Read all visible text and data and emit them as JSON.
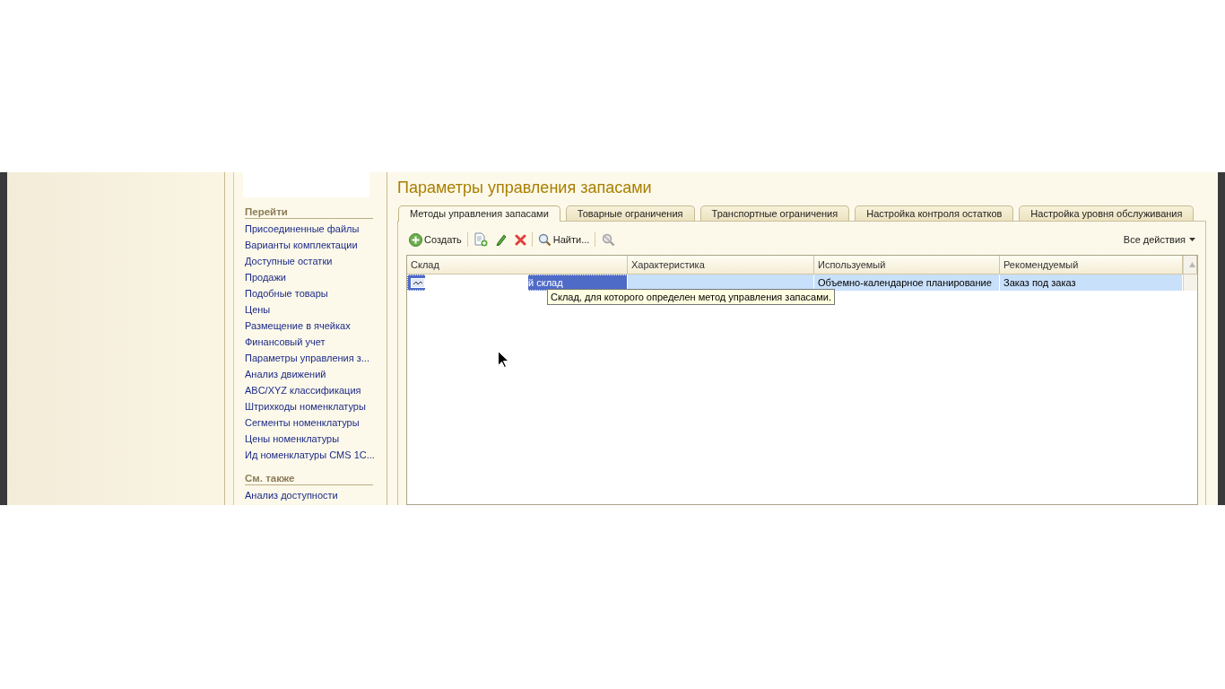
{
  "navigation": {
    "sections": [
      {
        "title": "Перейти",
        "links": [
          "Присоединенные файлы",
          "Варианты комплектации",
          "Доступные остатки",
          "Продажи",
          "Подобные товары",
          "Цены",
          "Размещение в ячейках",
          "Финансовый учет",
          "Параметры управления з...",
          "Анализ движений",
          "ABC/XYZ классификация",
          "Штрихкоды номенклатуры",
          "Сегменты номенклатуры",
          "Цены номенклатуры",
          "Ид номенклатуры CMS 1C..."
        ]
      },
      {
        "title": "См. также",
        "links": [
          "Анализ доступности"
        ]
      }
    ]
  },
  "form": {
    "title": "Параметры управления запасами",
    "tabs": [
      {
        "label": "Методы управления запасами",
        "selected": true
      },
      {
        "label": "Товарные ограничения",
        "selected": false
      },
      {
        "label": "Транспортные ограничения",
        "selected": false
      },
      {
        "label": "Настройка контроля остатков",
        "selected": false
      },
      {
        "label": "Настройка уровня обслуживания",
        "selected": false
      }
    ],
    "toolbar": {
      "buttons": [
        {
          "kind": "create",
          "label": "Создать"
        },
        {
          "kind": "copy"
        },
        {
          "kind": "edit"
        },
        {
          "kind": "delete"
        },
        {
          "kind": "find",
          "label": "Найти..."
        },
        {
          "kind": "clear-search"
        }
      ],
      "all_actions": "Все действия"
    },
    "table": {
      "columns": [
        "Склад",
        "Характеристика",
        "Используемый",
        "Рекомендуемый"
      ],
      "rows": [
        {
          "selected": true,
          "warehouse": "й склад",
          "used": "Объемно-календарное планирование",
          "recommended": "Заказ под заказ"
        }
      ]
    },
    "tooltip": "Склад, для которого определен метод управления запасами."
  }
}
